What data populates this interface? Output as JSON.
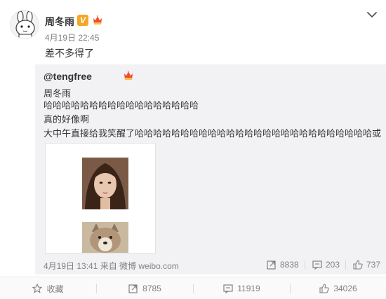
{
  "post": {
    "username": "周冬雨",
    "verify_mark": "V",
    "time": "4月19日 22:45",
    "text": "差不多得了"
  },
  "repost": {
    "author": "@tengfree",
    "lines": [
      "周冬雨",
      "哈哈哈哈哈哈哈哈哈哈哈哈哈哈哈哈哈",
      "真的好像啊",
      "大中午直接给我笑醒了哈哈哈哈哈哈哈哈哈哈哈哈哈哈哈哈哈哈哈哈哈哈哈哈哈哈或"
    ],
    "footer": {
      "date_source": "4月19日 13:41 来自 微博 weibo.com",
      "repost_count": "8838",
      "comment_count": "203",
      "like_count": "737"
    }
  },
  "actions": {
    "favorite_label": "收藏",
    "repost_count": "8785",
    "comment_count": "11919",
    "like_count": "34026"
  },
  "colors": {
    "verify_orange": "#f5a623",
    "vip_red": "#f04b3d",
    "meta_gray": "#808080",
    "repost_bg": "#f2f2f5"
  },
  "icons": {
    "menu": "chevron-down-icon",
    "repost": "share-arrow-icon",
    "comment": "comment-bubble-icon",
    "like": "thumbs-up-icon",
    "favorite": "star-icon"
  }
}
